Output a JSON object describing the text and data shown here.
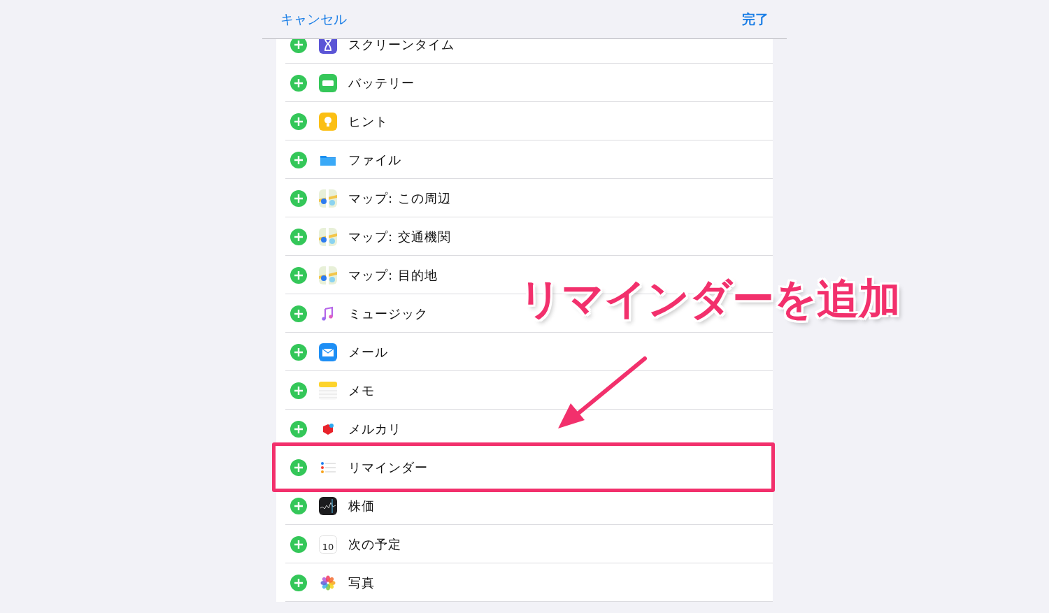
{
  "nav": {
    "cancel": "キャンセル",
    "done": "完了"
  },
  "items": [
    {
      "label": "スクリーンタイム",
      "highlighted": false
    },
    {
      "label": "バッテリー",
      "highlighted": false
    },
    {
      "label": "ヒント",
      "highlighted": false
    },
    {
      "label": "ファイル",
      "highlighted": false
    },
    {
      "label": "マップ: この周辺",
      "highlighted": false
    },
    {
      "label": "マップ: 交通機関",
      "highlighted": false
    },
    {
      "label": "マップ: 目的地",
      "highlighted": false
    },
    {
      "label": "ミュージック",
      "highlighted": false
    },
    {
      "label": "メール",
      "highlighted": false
    },
    {
      "label": "メモ",
      "highlighted": false
    },
    {
      "label": "メルカリ",
      "highlighted": false
    },
    {
      "label": "リマインダー",
      "highlighted": true
    },
    {
      "label": "株価",
      "highlighted": false
    },
    {
      "label": "次の予定",
      "date": "10",
      "highlighted": false
    },
    {
      "label": "写真",
      "highlighted": false
    }
  ],
  "annotation": {
    "text": "リマインダーを追加"
  }
}
